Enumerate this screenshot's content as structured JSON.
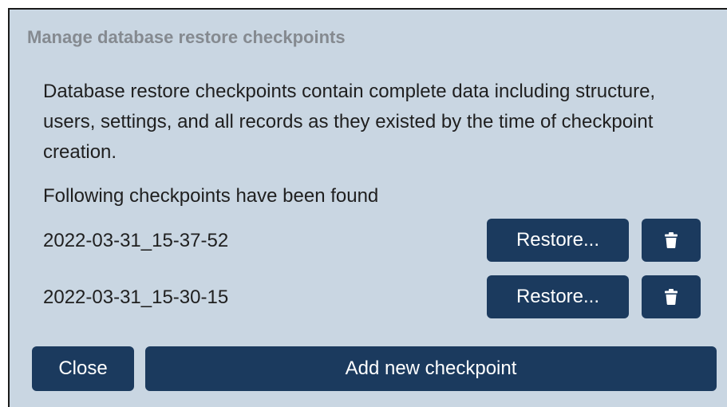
{
  "dialog": {
    "title": "Manage database restore checkpoints",
    "description": "Database restore checkpoints contain complete data including structure, users, settings, and all records as they existed by the time of checkpoint creation.",
    "found_label": "Following checkpoints have been found",
    "checkpoints": [
      {
        "name": "2022-03-31_15-37-52",
        "restore_label": "Restore..."
      },
      {
        "name": "2022-03-31_15-30-15",
        "restore_label": "Restore..."
      }
    ],
    "close_label": "Close",
    "add_label": "Add new checkpoint"
  },
  "icons": {
    "delete": "trash-icon"
  },
  "colors": {
    "dialog_background": "#c9d6e2",
    "button_background": "#1b3a5e",
    "button_text": "#ffffff",
    "title_text": "#858a90",
    "body_text": "#1f1f1f"
  }
}
